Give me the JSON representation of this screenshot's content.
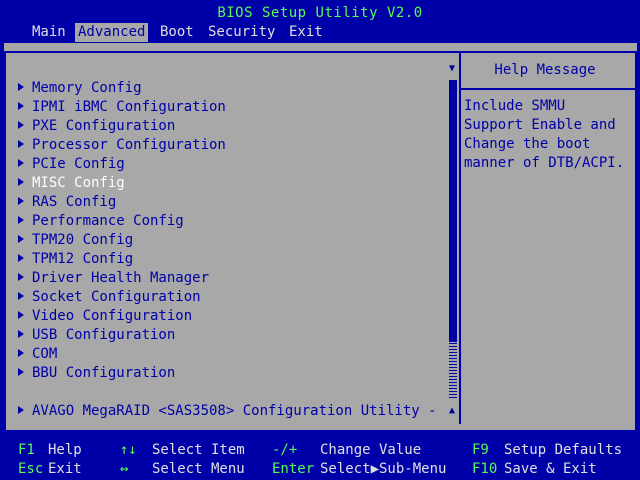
{
  "title": "BIOS Setup Utility V2.0",
  "menu": [
    {
      "label": "Main",
      "active": false
    },
    {
      "label": "Advanced",
      "active": true
    },
    {
      "label": "Boot",
      "active": false
    },
    {
      "label": "Security",
      "active": false
    },
    {
      "label": "Exit",
      "active": false
    }
  ],
  "items": [
    {
      "label": "Memory Config"
    },
    {
      "label": "IPMI iBMC Configuration"
    },
    {
      "label": "PXE Configuration"
    },
    {
      "label": "Processor Configuration"
    },
    {
      "label": "PCIe Config"
    },
    {
      "label": "MISC Config",
      "selected": true
    },
    {
      "label": "RAS Config"
    },
    {
      "label": "Performance Config"
    },
    {
      "label": "TPM20 Config"
    },
    {
      "label": "TPM12 Config"
    },
    {
      "label": "Driver Health Manager"
    },
    {
      "label": "Socket Configuration"
    },
    {
      "label": "Video Configuration"
    },
    {
      "label": "USB Configuration"
    },
    {
      "label": "COM"
    },
    {
      "label": "BBU Configuration"
    },
    {
      "label": "AVAGO MegaRAID <SAS3508> Configuration Utility -"
    }
  ],
  "help": {
    "title": "Help Message",
    "text": "Include SMMU\nSupport Enable and\nChange the boot\nmanner of DTB/ACPI."
  },
  "footer": {
    "f1_key": "F1",
    "f1_desc": "Help",
    "esc_key": "Esc",
    "esc_desc": "Exit",
    "updown_key": "↑↓",
    "updown_desc": "Select Item",
    "leftright_key": "↔",
    "leftright_desc": "Select Menu",
    "plusminus_key": "-/+",
    "plusminus_desc": "Change Value",
    "enter_key": "Enter",
    "enter_desc": "Select▶Sub-Menu",
    "f9_key": "F9",
    "f9_desc": "Setup Defaults",
    "f10_key": "F10",
    "f10_desc": "Save & Exit"
  },
  "scroll": {
    "up_icon": "▲",
    "down_icon": "▼"
  },
  "colors": {
    "background": "#0000a8",
    "panel": "#a8a8a8",
    "accent": "#54fc54",
    "text": "#e0e0e0"
  }
}
